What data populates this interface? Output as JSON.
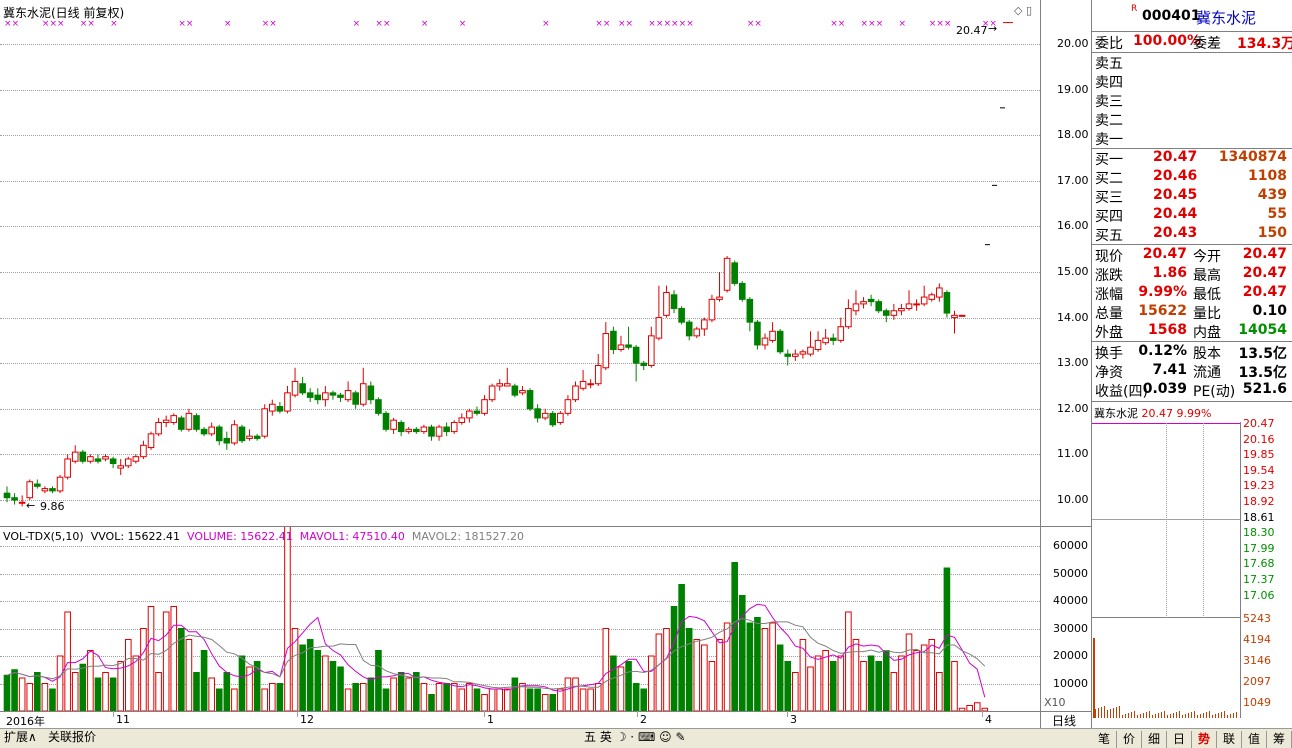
{
  "chart_title": "冀东水泥(日线 前复权)",
  "price_axis": [
    "20.00",
    "19.00",
    "18.00",
    "17.00",
    "16.00",
    "15.00",
    "14.00",
    "13.00",
    "12.00",
    "11.00",
    "10.00"
  ],
  "vol_axis": [
    "60000",
    "50000",
    "40000",
    "30000",
    "20000",
    "10000"
  ],
  "vol_axis_unit": "X10",
  "x_axis_labels": [
    "2016年",
    "11",
    "12",
    "1",
    "2",
    "3",
    "4"
  ],
  "period_button": "日线",
  "high_marker": "20.47",
  "low_marker": "9.86",
  "vol_legend": {
    "name": "VOL-TDX(5,10)",
    "vvol": "VVOL: 15622.41",
    "volume": "VOLUME: 15622.41",
    "mavol1": "MAVOL1: 47510.40",
    "mavol2": "MAVOL2: 181527.20"
  },
  "quote": {
    "code": "000401",
    "name": "冀东水泥",
    "flag": "R",
    "ratio_label": "委比",
    "ratio_value": "100.00%",
    "diff_label": "委差",
    "diff_value": "134.3万",
    "sells": [
      {
        "label": "卖五",
        "price": "",
        "vol": ""
      },
      {
        "label": "卖四",
        "price": "",
        "vol": ""
      },
      {
        "label": "卖三",
        "price": "",
        "vol": ""
      },
      {
        "label": "卖二",
        "price": "",
        "vol": ""
      },
      {
        "label": "卖一",
        "price": "",
        "vol": ""
      }
    ],
    "buys": [
      {
        "label": "买一",
        "price": "20.47",
        "vol": "1340874"
      },
      {
        "label": "买二",
        "price": "20.46",
        "vol": "1108"
      },
      {
        "label": "买三",
        "price": "20.45",
        "vol": "439"
      },
      {
        "label": "买四",
        "price": "20.44",
        "vol": "55"
      },
      {
        "label": "买五",
        "price": "20.43",
        "vol": "150"
      }
    ],
    "stats": [
      {
        "l1": "现价",
        "v1": "20.47",
        "l2": "今开",
        "v2": "20.47"
      },
      {
        "l1": "涨跌",
        "v1": "1.86",
        "l2": "最高",
        "v2": "20.47"
      },
      {
        "l1": "涨幅",
        "v1": "9.99%",
        "l2": "最低",
        "v2": "20.47"
      },
      {
        "l1": "总量",
        "v1": "15622",
        "l2": "量比",
        "v2": "0.10"
      },
      {
        "l1": "外盘",
        "v1": "1568",
        "l2": "内盘",
        "v2": "14054"
      }
    ],
    "stats2": [
      {
        "l1": "换手",
        "v1": "0.12%",
        "l2": "股本",
        "v2": "13.5亿"
      },
      {
        "l1": "净资",
        "v1": "7.41",
        "l2": "流通",
        "v2": "13.5亿"
      },
      {
        "l1": "收益(四)",
        "v1": "0.039",
        "l2": "PE(动)",
        "v2": "521.6"
      }
    ]
  },
  "mini": {
    "title": "冀东水泥",
    "price": "20.47",
    "pct": "9.99%",
    "price_axis": [
      "20.47",
      "20.16",
      "19.85",
      "19.54",
      "19.23",
      "18.92",
      "18.61",
      "18.30",
      "17.99",
      "17.68",
      "17.37",
      "17.06"
    ],
    "vol_axis": [
      "5243",
      "4194",
      "3146",
      "2097",
      "1049"
    ]
  },
  "bottom_tabs": [
    "扩展∧",
    "关联报价"
  ],
  "tool_icons": [
    "五",
    "英"
  ],
  "right_tabs": [
    "笔",
    "价",
    "细",
    "日",
    "势",
    "联",
    "值",
    "筹"
  ],
  "colors": {
    "up": "#e00000",
    "down": "#008000",
    "ma1": "#d000d0",
    "ma2": "#808080",
    "grid": "#a0a0a0"
  },
  "chart_data": {
    "type": "candlestick",
    "title": "冀东水泥(日线 前复权)",
    "ylim": [
      9.5,
      20.5
    ],
    "candles": [
      [
        10.15,
        10.05,
        10.3,
        9.95
      ],
      [
        10.05,
        10.0,
        10.15,
        9.9
      ],
      [
        9.95,
        9.95,
        10.1,
        9.86
      ],
      [
        10.05,
        10.4,
        10.45,
        10.0
      ],
      [
        10.35,
        10.3,
        10.45,
        10.25
      ],
      [
        10.2,
        10.25,
        10.3,
        10.15
      ],
      [
        10.25,
        10.2,
        10.3,
        10.15
      ],
      [
        10.2,
        10.5,
        10.55,
        10.15
      ],
      [
        10.5,
        10.9,
        11.0,
        10.45
      ],
      [
        10.85,
        11.05,
        11.2,
        10.8
      ],
      [
        11.05,
        10.85,
        11.1,
        10.8
      ],
      [
        10.85,
        10.95,
        11.0,
        10.8
      ],
      [
        10.9,
        10.85,
        11.0,
        10.8
      ],
      [
        10.9,
        10.95,
        11.0,
        10.85
      ],
      [
        10.9,
        10.8,
        10.95,
        10.7
      ],
      [
        10.7,
        10.75,
        10.9,
        10.55
      ],
      [
        10.75,
        10.9,
        10.95,
        10.7
      ],
      [
        10.85,
        10.95,
        11.0,
        10.8
      ],
      [
        10.95,
        11.2,
        11.3,
        10.9
      ],
      [
        11.15,
        11.45,
        11.5,
        11.1
      ],
      [
        11.45,
        11.7,
        11.8,
        11.4
      ],
      [
        11.7,
        11.75,
        11.85,
        11.6
      ],
      [
        11.7,
        11.85,
        11.9,
        11.65
      ],
      [
        11.8,
        11.55,
        11.85,
        11.5
      ],
      [
        11.55,
        11.9,
        12.0,
        11.5
      ],
      [
        11.85,
        11.55,
        11.9,
        11.5
      ],
      [
        11.55,
        11.45,
        11.6,
        11.4
      ],
      [
        11.45,
        11.6,
        11.7,
        11.4
      ],
      [
        11.6,
        11.3,
        11.65,
        11.2
      ],
      [
        11.35,
        11.25,
        11.5,
        11.1
      ],
      [
        11.25,
        11.65,
        11.75,
        11.2
      ],
      [
        11.6,
        11.3,
        11.65,
        11.25
      ],
      [
        11.35,
        11.4,
        11.55,
        11.3
      ],
      [
        11.4,
        11.35,
        11.45,
        11.3
      ],
      [
        11.4,
        12.0,
        12.1,
        11.35
      ],
      [
        11.95,
        12.1,
        12.2,
        11.85
      ],
      [
        12.05,
        11.95,
        12.15,
        11.9
      ],
      [
        11.95,
        12.35,
        12.5,
        11.9
      ],
      [
        12.3,
        12.6,
        12.9,
        12.25
      ],
      [
        12.55,
        12.35,
        12.7,
        12.3
      ],
      [
        12.35,
        12.25,
        12.45,
        12.15
      ],
      [
        12.3,
        12.2,
        12.45,
        12.1
      ],
      [
        12.2,
        12.35,
        12.5,
        12.05
      ],
      [
        12.35,
        12.3,
        12.4,
        12.2
      ],
      [
        12.3,
        12.25,
        12.35,
        12.15
      ],
      [
        12.2,
        12.4,
        12.6,
        12.15
      ],
      [
        12.35,
        12.1,
        12.4,
        12.0
      ],
      [
        12.1,
        12.55,
        12.9,
        12.05
      ],
      [
        12.5,
        12.2,
        12.6,
        12.1
      ],
      [
        12.2,
        11.9,
        12.25,
        11.85
      ],
      [
        11.9,
        11.55,
        11.95,
        11.5
      ],
      [
        11.55,
        11.75,
        11.8,
        11.45
      ],
      [
        11.7,
        11.5,
        11.75,
        11.4
      ],
      [
        11.5,
        11.55,
        11.6,
        11.45
      ],
      [
        11.55,
        11.5,
        11.6,
        11.45
      ],
      [
        11.5,
        11.6,
        11.65,
        11.45
      ],
      [
        11.6,
        11.4,
        11.65,
        11.3
      ],
      [
        11.4,
        11.6,
        11.65,
        11.3
      ],
      [
        11.6,
        11.5,
        11.7,
        11.4
      ],
      [
        11.5,
        11.7,
        11.75,
        11.45
      ],
      [
        11.7,
        11.8,
        11.9,
        11.65
      ],
      [
        11.8,
        11.95,
        12.0,
        11.7
      ],
      [
        11.95,
        11.9,
        12.05,
        11.85
      ],
      [
        11.9,
        12.2,
        12.3,
        11.85
      ],
      [
        12.2,
        12.5,
        12.55,
        12.15
      ],
      [
        12.5,
        12.55,
        12.65,
        12.4
      ],
      [
        12.5,
        12.55,
        12.9,
        12.5
      ],
      [
        12.5,
        12.3,
        12.55,
        12.25
      ],
      [
        12.35,
        12.4,
        12.5,
        12.3
      ],
      [
        12.4,
        12.0,
        12.45,
        11.95
      ],
      [
        12.0,
        11.8,
        12.1,
        11.7
      ],
      [
        11.8,
        11.9,
        12.0,
        11.75
      ],
      [
        11.9,
        11.65,
        11.95,
        11.6
      ],
      [
        11.7,
        11.9,
        11.95,
        11.65
      ],
      [
        11.9,
        12.2,
        12.3,
        11.85
      ],
      [
        12.2,
        12.5,
        12.6,
        12.15
      ],
      [
        12.45,
        12.6,
        12.85,
        12.4
      ],
      [
        12.55,
        12.55,
        12.65,
        12.45
      ],
      [
        12.55,
        12.95,
        13.2,
        12.5
      ],
      [
        12.9,
        13.65,
        13.9,
        12.85
      ],
      [
        13.7,
        13.3,
        13.8,
        13.2
      ],
      [
        13.3,
        13.4,
        13.6,
        13.25
      ],
      [
        13.4,
        13.35,
        13.8,
        13.3
      ],
      [
        13.35,
        13.0,
        13.4,
        12.6
      ],
      [
        13.0,
        12.95,
        13.05,
        12.85
      ],
      [
        12.95,
        13.6,
        13.8,
        12.9
      ],
      [
        13.55,
        14.0,
        14.7,
        13.5
      ],
      [
        14.05,
        14.55,
        14.7,
        14.0
      ],
      [
        14.5,
        14.2,
        14.6,
        14.1
      ],
      [
        14.2,
        13.9,
        14.25,
        13.85
      ],
      [
        13.9,
        13.6,
        13.95,
        13.5
      ],
      [
        13.6,
        13.75,
        13.8,
        13.55
      ],
      [
        13.75,
        13.95,
        14.0,
        13.6
      ],
      [
        13.95,
        14.4,
        14.5,
        13.9
      ],
      [
        14.4,
        14.45,
        15.0,
        14.35
      ],
      [
        14.6,
        15.3,
        15.35,
        14.55
      ],
      [
        15.2,
        14.75,
        15.25,
        14.7
      ],
      [
        14.75,
        14.4,
        14.8,
        14.35
      ],
      [
        14.4,
        13.9,
        14.45,
        13.7
      ],
      [
        13.9,
        13.4,
        13.95,
        13.3
      ],
      [
        13.4,
        13.55,
        13.65,
        13.3
      ],
      [
        13.5,
        13.7,
        13.9,
        13.45
      ],
      [
        13.7,
        13.25,
        13.75,
        13.2
      ],
      [
        13.2,
        13.15,
        13.3,
        12.95
      ],
      [
        13.15,
        13.2,
        13.3,
        13.05
      ],
      [
        13.2,
        13.25,
        13.3,
        13.1
      ],
      [
        13.2,
        13.35,
        13.7,
        13.15
      ],
      [
        13.3,
        13.5,
        13.7,
        13.25
      ],
      [
        13.45,
        13.55,
        13.75,
        13.4
      ],
      [
        13.55,
        13.5,
        13.65,
        13.4
      ],
      [
        13.5,
        13.8,
        14.0,
        13.45
      ],
      [
        13.8,
        14.2,
        14.4,
        13.75
      ],
      [
        14.15,
        14.3,
        14.6,
        14.05
      ],
      [
        14.3,
        14.35,
        14.45,
        14.2
      ],
      [
        14.4,
        14.35,
        14.5,
        14.25
      ],
      [
        14.35,
        14.15,
        14.4,
        14.1
      ],
      [
        14.15,
        14.05,
        14.2,
        13.9
      ],
      [
        14.05,
        14.15,
        14.3,
        13.95
      ],
      [
        14.15,
        14.2,
        14.3,
        14.05
      ],
      [
        14.2,
        14.3,
        14.6,
        14.15
      ],
      [
        14.3,
        14.3,
        14.4,
        14.15
      ],
      [
        14.3,
        14.45,
        14.7,
        14.25
      ],
      [
        14.4,
        14.5,
        14.55,
        14.35
      ],
      [
        14.45,
        14.65,
        14.75,
        14.35
      ],
      [
        14.55,
        14.1,
        14.6,
        14.0
      ],
      [
        14.0,
        14.05,
        14.15,
        13.65
      ],
      [
        14.05,
        14.05,
        14.05,
        14.05
      ]
    ],
    "volumes": [
      13,
      15,
      12,
      10,
      14,
      10,
      8,
      20,
      36,
      14,
      17,
      22,
      12,
      14,
      12,
      18,
      26,
      20,
      30,
      38,
      14,
      36,
      38,
      30,
      26,
      14,
      22,
      12,
      8,
      14,
      8,
      20,
      16,
      18,
      8,
      10,
      10,
      68,
      30,
      24,
      26,
      22,
      20,
      18,
      16,
      8,
      10,
      10,
      12,
      22,
      8,
      12,
      14,
      12,
      14,
      10,
      6,
      10,
      10,
      10,
      8,
      10,
      8,
      6,
      8,
      8,
      8,
      12,
      10,
      8,
      8,
      6,
      6,
      8,
      12,
      12,
      8,
      8,
      10,
      30,
      20,
      16,
      18,
      10,
      8,
      20,
      28,
      30,
      38,
      46,
      30,
      26,
      24,
      18,
      26,
      32,
      54,
      42,
      32,
      34,
      30,
      32,
      24,
      18,
      14,
      26,
      16,
      20,
      22,
      18,
      20,
      36,
      26,
      18,
      20,
      18,
      22,
      14,
      20,
      28,
      22,
      24,
      26,
      14,
      52,
      18,
      1,
      2,
      3,
      1
    ],
    "ma_top_close": 20.47
  }
}
